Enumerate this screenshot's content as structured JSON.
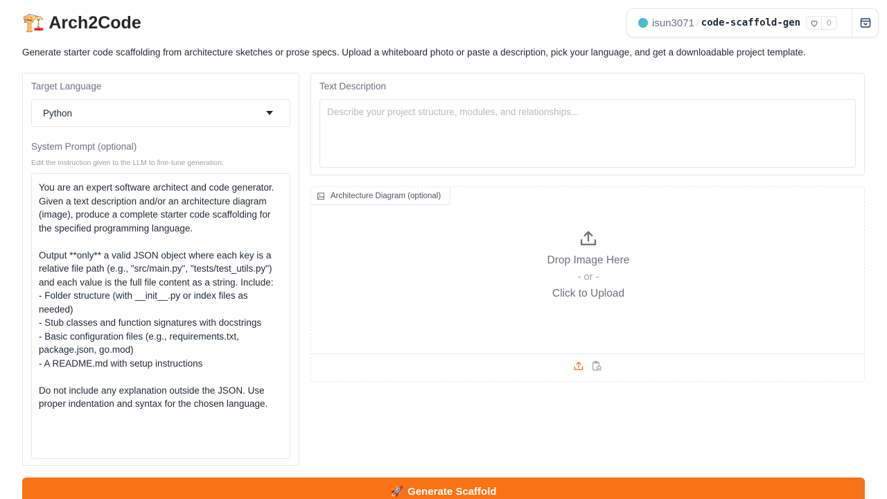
{
  "app": {
    "emoji": "🏗️",
    "title": "Arch2Code",
    "description": "Generate starter code scaffolding from architecture sketches or prose specs. Upload a whiteboard photo or paste a description, pick your language, and get a downloadable project template."
  },
  "space": {
    "user": "isun3071",
    "separator": "/",
    "repo": "code-scaffold-gen",
    "likes": "0"
  },
  "language": {
    "label": "Target Language",
    "selected": "Python"
  },
  "system_prompt": {
    "label": "System Prompt (optional)",
    "info": "Edit the instruction given to the LLM to fine-tune generation.",
    "value": "You are an expert software architect and code generator. Given a text description and/or an architecture diagram (image), produce a complete starter code scaffolding for the specified programming language.\n\nOutput **only** a valid JSON object where each key is a relative file path (e.g., \"src/main.py\", \"tests/test_utils.py\") and each value is the full file content as a string. Include:\n- Folder structure (with __init__.py or index files as needed)\n- Stub classes and function signatures with docstrings\n- Basic configuration files (e.g., requirements.txt, package.json, go.mod)\n- A README.md with setup instructions\n\nDo not include any explanation outside the JSON. Use proper indentation and syntax for the chosen language."
  },
  "text_description": {
    "label": "Text Description",
    "placeholder": "Describe your project structure, modules, and relationships..."
  },
  "image_upload": {
    "label": "Architecture Diagram (optional)",
    "drop_text": "Drop Image Here",
    "or_text": "- or -",
    "click_text": "Click to Upload"
  },
  "generate": {
    "emoji": "🚀",
    "label": "Generate Scaffold",
    "color": "#f97316"
  }
}
